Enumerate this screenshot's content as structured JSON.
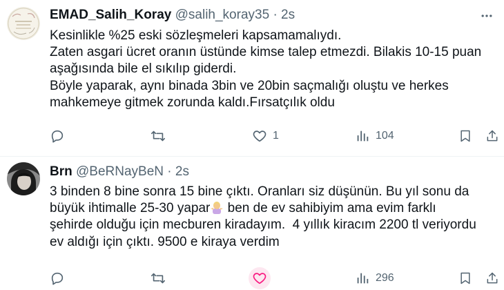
{
  "colors": {
    "text": "#0f1419",
    "muted": "#536471",
    "like_accent": "#f91880",
    "border": "#eff3f4"
  },
  "tweets": [
    {
      "author": {
        "name": "EMAD_Salih_Koray",
        "handle": "@salih_koray35",
        "time": "2s"
      },
      "dot": "·",
      "lines": [
        "Kesinlikle %25 eski sözleşmeleri kapsamamalıydı.",
        "Zaten asgari ücret oranın üstünde kimse talep etmezdi. Bilakis 10-15 puan",
        "aşağısında bile el sıkılıp giderdi.",
        "Böyle yaparak, aynı binada 3bin ve 20bin saçmalığı oluştu ve herkes",
        "mahkemeye gitmek zorunda kaldı.Fırsatçılık oldu"
      ],
      "actions": {
        "reply_icon": "reply-icon",
        "retweet_icon": "retweet-icon",
        "like_icon": "heart-icon",
        "like_count": "1",
        "views_icon": "views-chart-icon",
        "views_count": "104",
        "bookmark_icon": "bookmark-icon",
        "share_icon": "share-icon"
      }
    },
    {
      "author": {
        "name": "Brn",
        "handle": "@BeRNayBeN",
        "time": "2s"
      },
      "dot": "·",
      "lines_before_emoji": "3 binden 8 bine sonra 15 bine çıktı. Oranları siz düşünün. Bu yıl sonu da büyük ihtimalle 25-30 yapar",
      "emoji": "woman-shrugging-emoji",
      "lines_after_emoji": " ben de ev sahibiyim ama evim farklı şehirde olduğu için mecburen kiradayım.  4 yıllık kiracım 2200 tl veriyordu ev aldığı için çıktı. 9500 e kiraya verdim",
      "actions": {
        "reply_icon": "reply-icon",
        "retweet_icon": "retweet-icon",
        "like_icon": "heart-icon",
        "like_state": "hover",
        "views_icon": "views-chart-icon",
        "views_count": "296",
        "bookmark_icon": "bookmark-icon",
        "share_icon": "share-icon"
      }
    }
  ]
}
